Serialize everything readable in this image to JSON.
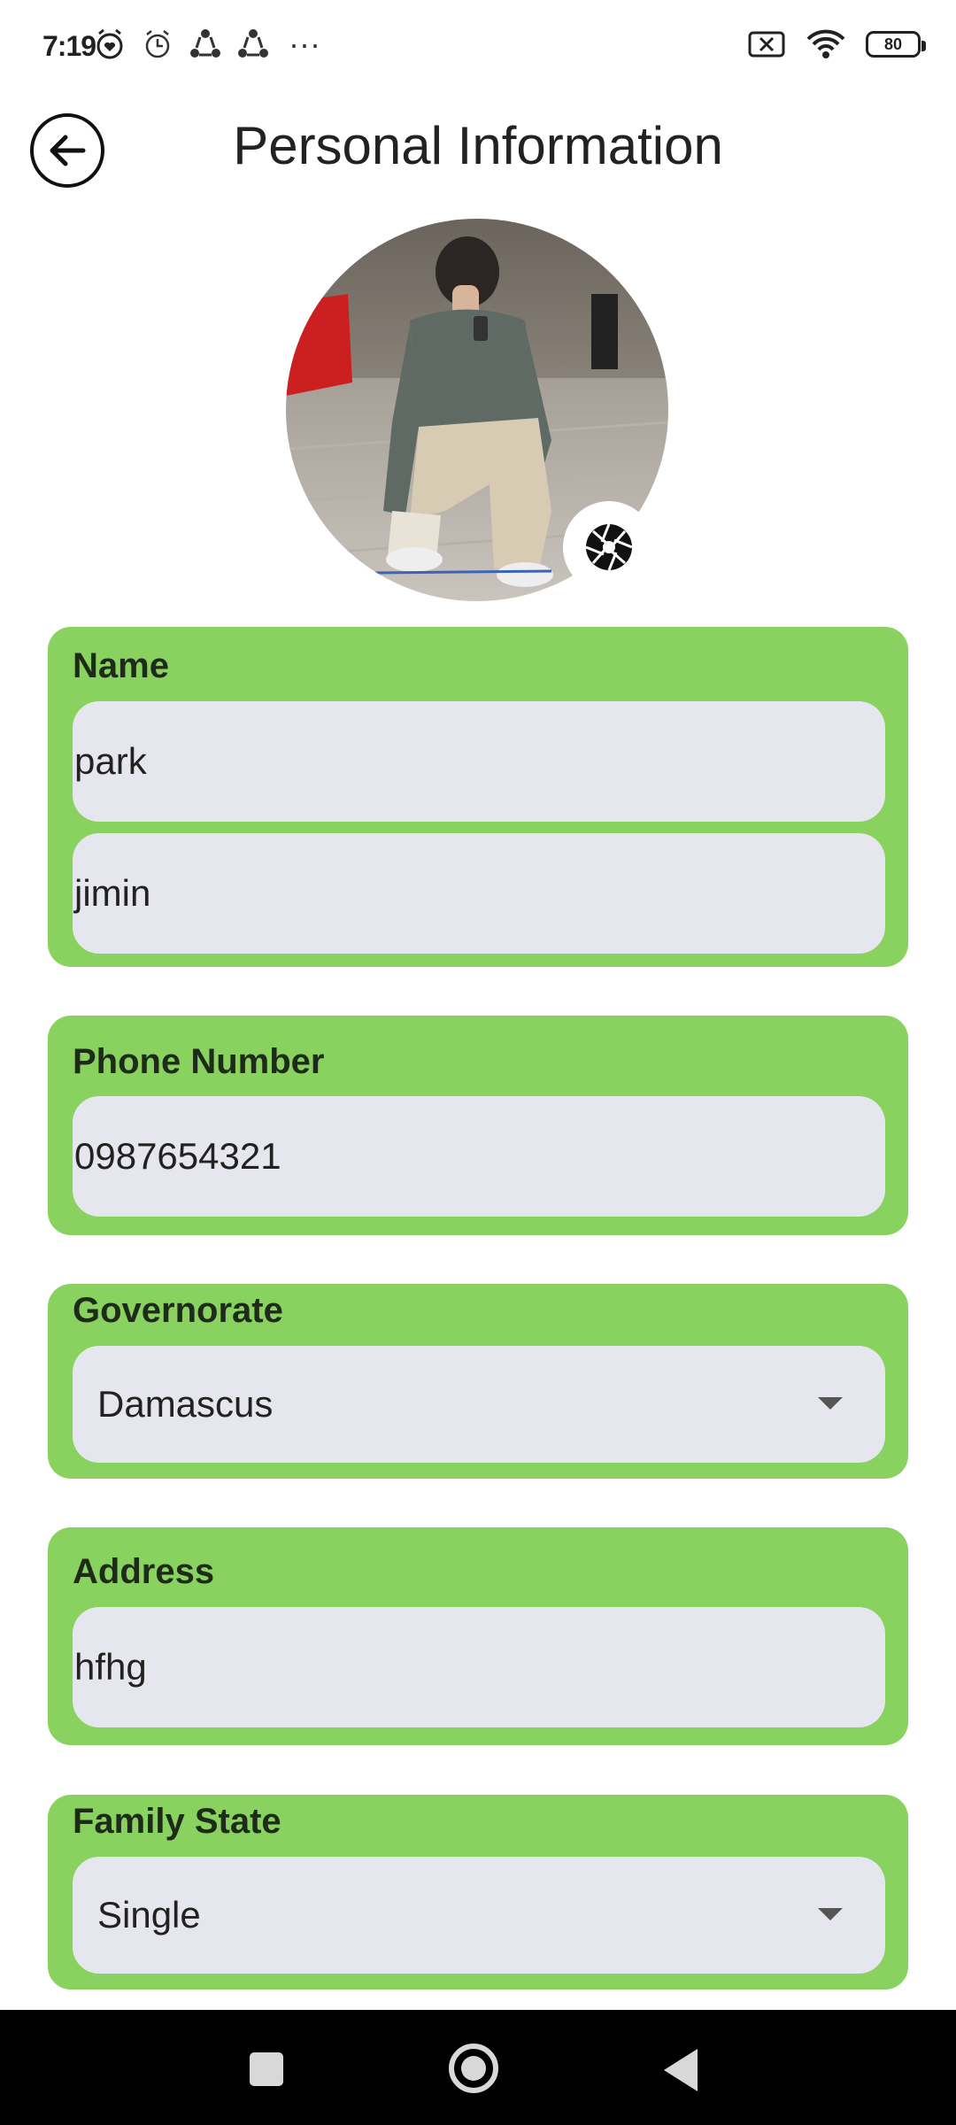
{
  "status_bar": {
    "time": "7:19",
    "battery": "80",
    "more": "···"
  },
  "header": {
    "title": "Personal Information"
  },
  "form": {
    "name": {
      "label": "Name",
      "first_name": "park",
      "last_name": "jimin"
    },
    "phone": {
      "label": "Phone Number",
      "value": "0987654321"
    },
    "governorate": {
      "label": "Governorate",
      "value": "Damascus"
    },
    "address": {
      "label": "Address",
      "value": "hfhg"
    },
    "family_state": {
      "label": "Family State",
      "value": "Single"
    }
  },
  "colors": {
    "card_bg": "#89d25f",
    "field_bg": "#e6e7ee",
    "nav_bg": "#000000"
  }
}
